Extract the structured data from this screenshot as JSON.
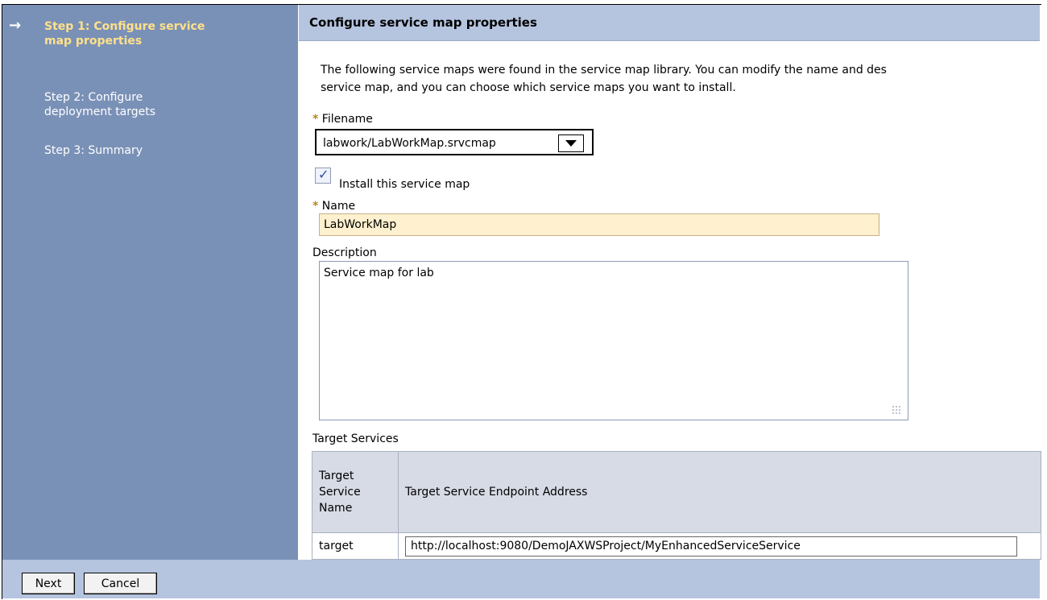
{
  "sidebar": {
    "steps": [
      {
        "label": "Step 1: Configure service map properties",
        "active": true
      },
      {
        "label": "Step 2: Configure deployment targets",
        "active": false
      },
      {
        "label": "Step 3: Summary",
        "active": false
      }
    ],
    "current_icon": "right-arrow-icon"
  },
  "main": {
    "title": "Configure service map properties",
    "intro_line1": "The following service maps were found in the service map library. You can modify the name and des",
    "intro_line2": "service map, and you can choose which service maps you want to install.",
    "required_marker": "*",
    "filename_label": "Filename",
    "filename_value": "labwork/LabWorkMap.srvcmap",
    "install_checkbox_label": "Install this service map",
    "install_checked": true,
    "name_label": "Name",
    "name_value": "LabWorkMap",
    "description_label": "Description",
    "description_value": "Service map for lab",
    "target_services_label": "Target Services",
    "table": {
      "headers": [
        "Target Service Name",
        "Target Service Endpoint Address"
      ],
      "rows": [
        {
          "name": "target",
          "endpoint": "http://localhost:9080/DemoJAXWSProject/MyEnhancedServiceService"
        }
      ]
    }
  },
  "footer": {
    "next_label": "Next",
    "cancel_label": "Cancel"
  },
  "colors": {
    "sidebar_bg": "#7a91b7",
    "active_step": "#ffe08a",
    "header_bg": "#b5c4df",
    "required_marker": "#b5891e",
    "input_bg": "#fff1cf"
  }
}
